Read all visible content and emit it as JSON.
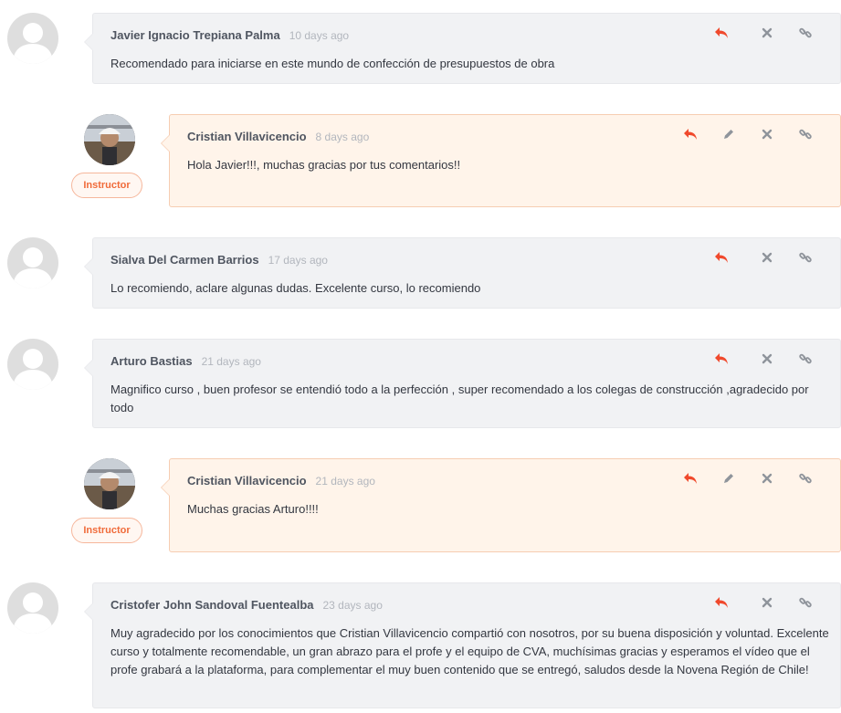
{
  "comments": [
    {
      "author": "Javier Ignacio Trepiana Palma",
      "time": "10 days ago",
      "text": "Recomendado para iniciarse en este mundo de confección de presupuestos de obra",
      "avatar": "default-avatar"
    },
    {
      "author": "Cristian Villavicencio",
      "time": "8 days ago",
      "text": "Hola Javier!!!, muchas gracias por tus comentarios!!",
      "avatar": "instructor-photo",
      "badge": "Instructor"
    },
    {
      "author": "Sialva Del Carmen Barrios",
      "time": "17 days ago",
      "text": "Lo recomiendo, aclare algunas dudas. Excelente curso, lo recomiendo",
      "avatar": "default-avatar"
    },
    {
      "author": "Arturo Bastias",
      "time": "21 days ago",
      "text": "Magnifico curso , buen profesor se entendió todo a la perfección , super recomendado a los colegas de construcción ,agradecido por todo",
      "avatar": "default-avatar"
    },
    {
      "author": "Cristian Villavicencio",
      "time": "21 days ago",
      "text": "Muchas gracias Arturo!!!!",
      "avatar": "instructor-photo",
      "badge": "Instructor"
    },
    {
      "author": "Cristofer John Sandoval Fuentealba",
      "time": "23 days ago",
      "text": "Muy agradecido por los conocimientos que Cristian Villavicencio compartió con nosotros, por su buena disposición y voluntad. Excelente curso y totalmente recomendable, un gran abrazo para el profe y el equipo de CVA, muchísimas gracias y esperamos el vídeo que el profe grabará a la plataforma, para complementar el muy buen contenido que se entregó, saludos desde la Novena Región de Chile!",
      "avatar": "default-avatar"
    }
  ],
  "icons": {
    "reply": "reply-icon",
    "edit": "pencil-icon",
    "delete": "close-icon",
    "link": "link-icon"
  },
  "colors": {
    "accent": "#f0492c",
    "icon_gray": "#8f949b",
    "instructor_bubble": "#fff4ea",
    "instructor_border": "#f6cdb2",
    "student_bubble": "#f1f2f4",
    "badge_text": "#f06b3a"
  }
}
